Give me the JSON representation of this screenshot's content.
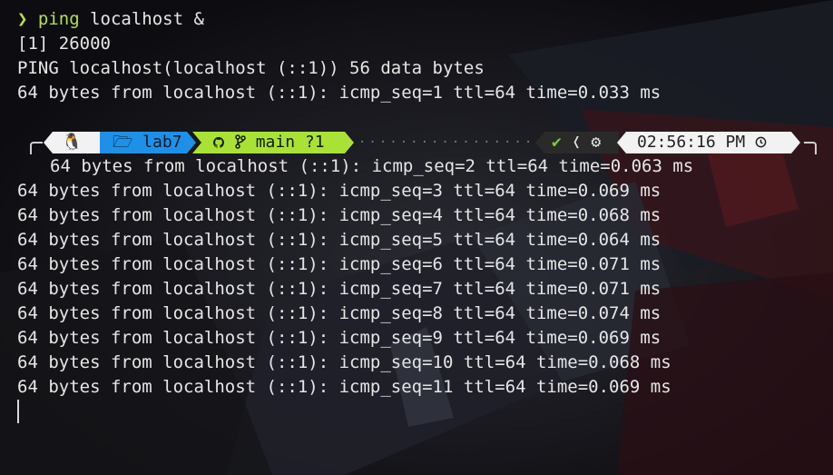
{
  "prompt_char": "❯",
  "command": "ping",
  "command_args": " localhost &",
  "lines_before": [
    "[1] 26000",
    "PING localhost(localhost (::1)) 56 data bytes",
    "64 bytes from localhost (::1): icmp_seq=1 ttl=64 time=0.033 ms",
    ""
  ],
  "prompt_bar": {
    "os_icon": "🐧",
    "dir_icon": "🗁",
    "dir": "lab7",
    "git_icon": "git-icon",
    "branch_icon": "branch-icon",
    "branch": "main ?1",
    "dots": "·················",
    "status_ok": "✔",
    "status_sep": "❬",
    "gear": "⚙",
    "time": "02:56:16 PM",
    "clock_icon": "clock-icon"
  },
  "indented_line": "64 bytes from localhost (::1): icmp_seq=2 ttl=64 time=0.063 ms",
  "lines_after": [
    "64 bytes from localhost (::1): icmp_seq=3 ttl=64 time=0.069 ms",
    "64 bytes from localhost (::1): icmp_seq=4 ttl=64 time=0.068 ms",
    "64 bytes from localhost (::1): icmp_seq=5 ttl=64 time=0.064 ms",
    "64 bytes from localhost (::1): icmp_seq=6 ttl=64 time=0.071 ms",
    "64 bytes from localhost (::1): icmp_seq=7 ttl=64 time=0.071 ms",
    "64 bytes from localhost (::1): icmp_seq=8 ttl=64 time=0.074 ms",
    "64 bytes from localhost (::1): icmp_seq=9 ttl=64 time=0.069 ms",
    "64 bytes from localhost (::1): icmp_seq=10 ttl=64 time=0.068 ms",
    "64 bytes from localhost (::1): icmp_seq=11 ttl=64 time=0.069 ms"
  ],
  "colors": {
    "accent_green": "#a9e234",
    "dir_blue": "#1e90e8",
    "background": "#101014"
  }
}
